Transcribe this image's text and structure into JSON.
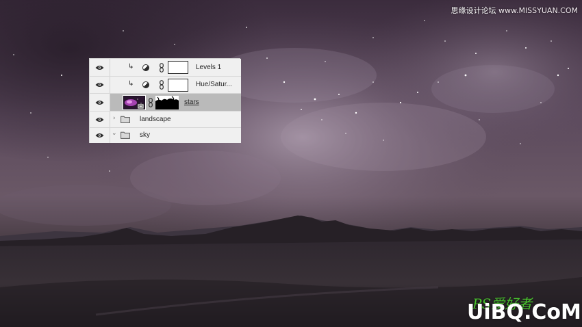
{
  "watermark": {
    "top_text": "思缘设计论坛",
    "top_site": "www.MISSYUAN.COM",
    "bottom_script": "PS爱好者",
    "bottom_logo": "UiBQ.CoM"
  },
  "colors": {
    "panel_bg": "#efefef",
    "row_selected": "#bababa",
    "watermark_green": "#49c22e",
    "sky_purple": "#5a4a5e"
  },
  "layers": {
    "items": [
      {
        "name": "Levels 1",
        "type": "adjustment",
        "clipped": true,
        "visible": true,
        "icon": "adjustment-layer-icon"
      },
      {
        "name": "Hue/Satur...",
        "type": "adjustment",
        "clipped": true,
        "visible": true,
        "icon": "adjustment-layer-icon"
      },
      {
        "name": "stars",
        "type": "smart-object-with-mask",
        "selected": true,
        "visible": true,
        "icon": "smart-object-icon"
      },
      {
        "name": "landscape",
        "type": "group",
        "expanded": false,
        "visible": true,
        "icon": "folder-icon"
      },
      {
        "name": "sky",
        "type": "group",
        "expanded": true,
        "visible": true,
        "icon": "folder-icon"
      }
    ]
  }
}
